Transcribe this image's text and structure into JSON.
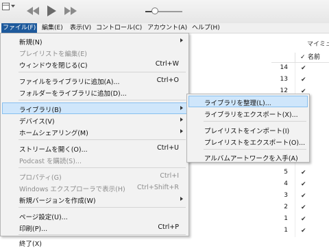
{
  "toolbar": {
    "icons": [
      "window-menu-icon",
      "previous-track-icon",
      "play-icon",
      "next-track-icon"
    ],
    "volume_level": 0.25
  },
  "menubar": [
    {
      "label": "ファイル(F)",
      "active": true
    },
    {
      "label": "編集(E)"
    },
    {
      "label": "表示(V)"
    },
    {
      "label": "コントロール(C)"
    },
    {
      "label": "アカウント(A)"
    },
    {
      "label": "ヘルプ(H)"
    }
  ],
  "file_menu": [
    {
      "label": "新規(N)",
      "submenu": true
    },
    {
      "label": "プレイリストを編集(E)",
      "disabled": true
    },
    {
      "label": "ウィンドウを閉じる(C)",
      "shortcut": "Ctrl+W"
    },
    {
      "separator": true
    },
    {
      "label": "ファイルをライブラリに追加(A)...",
      "shortcut": "Ctrl+O"
    },
    {
      "label": "フォルダーをライブラリに追加(D)..."
    },
    {
      "separator": true
    },
    {
      "label": "ライブラリ(B)",
      "submenu": true,
      "highlighted": true
    },
    {
      "label": "デバイス(V)",
      "submenu": true
    },
    {
      "label": "ホームシェアリング(M)",
      "submenu": true
    },
    {
      "separator": true
    },
    {
      "label": "ストリームを開く(O)...",
      "shortcut": "Ctrl+U"
    },
    {
      "label": "Podcast を購読(S)...",
      "disabled": true
    },
    {
      "separator": true
    },
    {
      "label": "プロパティ(G)",
      "shortcut": "Ctrl+I",
      "disabled": true
    },
    {
      "label": "Windows エクスプローラで表示(H)",
      "shortcut": "Ctrl+Shift+R",
      "disabled": true
    },
    {
      "label": "新規バージョンを作成(W)",
      "submenu": true
    },
    {
      "separator": true
    },
    {
      "label": "ページ設定(U)..."
    },
    {
      "label": "印刷(P)...",
      "shortcut": "Ctrl+P"
    },
    {
      "separator": true
    },
    {
      "label": "終了(X)"
    }
  ],
  "library_submenu": [
    {
      "label": "ライブラリを整理(L)...",
      "highlighted": true
    },
    {
      "label": "ライブラリをエクスポート(X)..."
    },
    {
      "separator": true
    },
    {
      "label": "プレイリストをインポート(I)"
    },
    {
      "label": "プレイリストをエクスポート(O)..."
    },
    {
      "separator": true
    },
    {
      "label": "アルバムアートワークを入手(A)"
    }
  ],
  "panel": {
    "title": "マイミュ",
    "column_check": "✓",
    "column_name": "名前",
    "rows": [
      "14",
      "13",
      "12",
      "",
      "",
      "",
      "",
      "",
      "",
      "5",
      "4",
      "3",
      "2",
      "1",
      "1"
    ]
  }
}
